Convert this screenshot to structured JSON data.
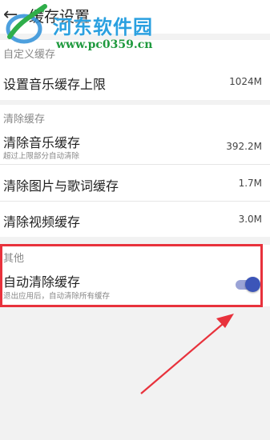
{
  "header": {
    "title": "缓存设置",
    "back_icon": "arrow-left-icon"
  },
  "watermark": {
    "site_name": "河东软件园",
    "url": "www.pc0359.cn"
  },
  "sections": {
    "custom": {
      "heading": "自定义缓存",
      "items": [
        {
          "label": "设置音乐缓存上限",
          "value": "1024M"
        }
      ]
    },
    "clear": {
      "heading": "清除缓存",
      "items": [
        {
          "label": "清除音乐缓存",
          "sub": "超过上限部分自动清除",
          "value": "392.2M"
        },
        {
          "label": "清除图片与歌词缓存",
          "value": "1.7M"
        },
        {
          "label": "清除视频缓存",
          "value": "3.0M"
        }
      ]
    },
    "other": {
      "heading": "其他",
      "items": [
        {
          "label": "自动清除缓存",
          "sub": "退出应用后，自动清除所有缓存",
          "toggle_on": true
        }
      ]
    }
  },
  "colors": {
    "toggle_on": "#3c55b8",
    "highlight": "#e8323c"
  }
}
